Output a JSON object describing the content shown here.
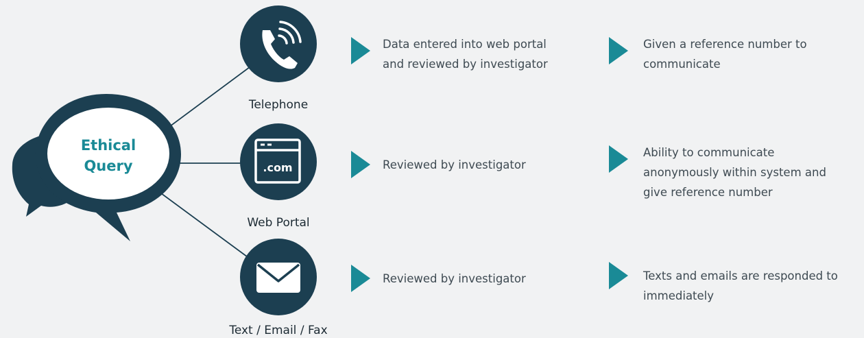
{
  "colors": {
    "background": "#f1f2f3",
    "dark_navy": "#1c3f51",
    "teal": "#1a8a96",
    "text": "#3e4a52",
    "icon_white": "#ffffff"
  },
  "hub": {
    "line1": "Ethical",
    "line2": "Query",
    "icon": "speech-bubbles-icon"
  },
  "channels": [
    {
      "label": "Telephone",
      "icon": "phone-icon",
      "step1": [
        "Data entered into web portal",
        "and reviewed by investigator"
      ],
      "step2": [
        "Given a reference number to",
        "communicate"
      ]
    },
    {
      "label": "Web Portal",
      "icon": "browser-window-icon",
      "icon_text": ".com",
      "step1": [
        "Reviewed by investigator"
      ],
      "step2": [
        "Ability to communicate",
        "anonymously within system and",
        "give reference number"
      ]
    },
    {
      "label": "Text / Email / Fax",
      "icon": "envelope-icon",
      "step1": [
        "Reviewed by investigator"
      ],
      "step2": [
        "Texts and emails are responded to",
        "immediately"
      ]
    }
  ]
}
